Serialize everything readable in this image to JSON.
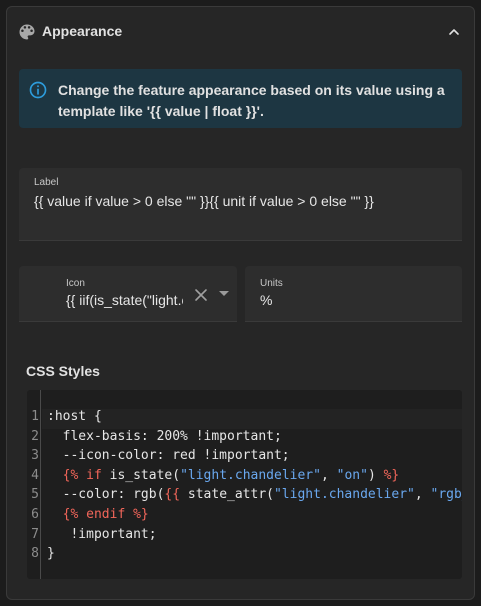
{
  "section": {
    "title": "Appearance",
    "icon": "palette-icon",
    "expand_icon": "chevron-up-icon"
  },
  "info": {
    "icon": "info-icon",
    "text": "Change the feature appearance based on its value using a template like '{{ value | float }}'."
  },
  "label_field": {
    "label": "Label",
    "value": "{{ value if value > 0 else \"\" }}{{ unit if value > 0 else \"\" }}"
  },
  "icon_field": {
    "label": "Icon",
    "value": "{{ iif(is_state(\"light.chandelier\", \"on\"), \"mdi:ceiling-light\", \"mdi:ceiling-light-outline\") }}"
  },
  "units_field": {
    "label": "Units",
    "value": "%"
  },
  "css": {
    "title": "CSS Styles",
    "line_numbers": [
      "1",
      "2",
      "3",
      "4",
      "5",
      "6",
      "7",
      "8"
    ],
    "lines": [
      [
        {
          "t": ":host {",
          "c": "plain"
        }
      ],
      [
        {
          "t": "  flex-basis: 200% !important;",
          "c": "plain"
        }
      ],
      [
        {
          "t": "  --icon-color: red !important;",
          "c": "plain"
        }
      ],
      [
        {
          "t": "  ",
          "c": "plain"
        },
        {
          "t": "{% ",
          "c": "red"
        },
        {
          "t": "if",
          "c": "kw"
        },
        {
          "t": " is_state(",
          "c": "plain"
        },
        {
          "t": "\"light.chandelier\"",
          "c": "str"
        },
        {
          "t": ", ",
          "c": "plain"
        },
        {
          "t": "\"on\"",
          "c": "str"
        },
        {
          "t": ") ",
          "c": "plain"
        },
        {
          "t": "%}",
          "c": "red"
        }
      ],
      [
        {
          "t": "  --color: rgb(",
          "c": "plain"
        },
        {
          "t": "{{",
          "c": "red"
        },
        {
          "t": " state_attr(",
          "c": "plain"
        },
        {
          "t": "\"light.chandelier\"",
          "c": "str"
        },
        {
          "t": ", ",
          "c": "plain"
        },
        {
          "t": "\"rgb_color\"",
          "c": "str"
        }
      ],
      [
        {
          "t": "  ",
          "c": "plain"
        },
        {
          "t": "{% ",
          "c": "red"
        },
        {
          "t": "endif",
          "c": "kw"
        },
        {
          "t": " %}",
          "c": "red"
        }
      ],
      [
        {
          "t": "   !important;",
          "c": "plain"
        }
      ],
      [
        {
          "t": "}",
          "c": "plain"
        }
      ]
    ]
  }
}
